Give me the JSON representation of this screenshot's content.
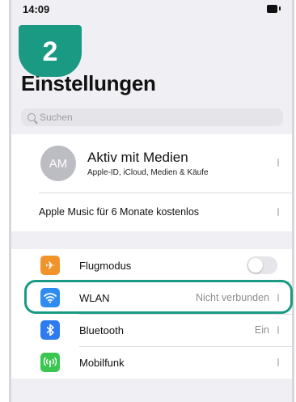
{
  "statusbar": {
    "time": "14:09"
  },
  "step_badge": "2",
  "header": {
    "title": "Einstellungen"
  },
  "search": {
    "placeholder": "Suchen"
  },
  "account": {
    "avatar_initials": "AM",
    "name": "Aktiv mit Medien",
    "subtitle": "Apple-ID, iCloud, Medien & Käufe",
    "promo": "Apple Music für 6 Monate kostenlos"
  },
  "settings": {
    "items": [
      {
        "label": "Flugmodus",
        "value": "",
        "icon": "airplane-icon",
        "color": "#f0932b",
        "toggle": false
      },
      {
        "label": "WLAN",
        "value": "Nicht verbunden",
        "icon": "wifi-icon",
        "color": "#2d8cf0"
      },
      {
        "label": "Bluetooth",
        "value": "Ein",
        "icon": "bluetooth-icon",
        "color": "#2d7bf0"
      },
      {
        "label": "Mobilfunk",
        "value": "",
        "icon": "antenna-icon",
        "color": "#3bc651"
      }
    ]
  },
  "colors": {
    "accent_highlight": "#1a9a82",
    "background": "#efeff4"
  }
}
